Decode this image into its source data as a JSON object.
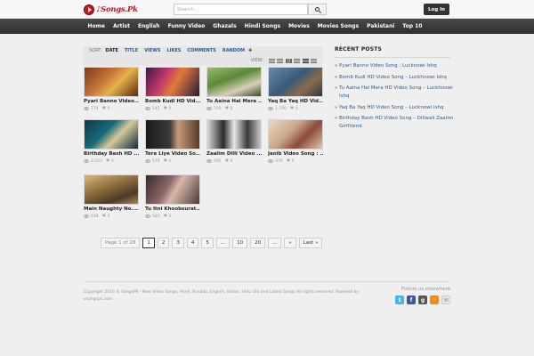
{
  "header": {
    "logo_text": "♪Songs.Pk",
    "search_placeholder": "Search...",
    "login_label": "Log In"
  },
  "nav": {
    "items": [
      "Home",
      "Artist",
      "English",
      "Funny Video",
      "Ghazals",
      "Hindi Songs",
      "Movies",
      "Movies Songs",
      "Pakistani",
      "Top 10"
    ]
  },
  "toolbar": {
    "sort_label": "SORT:",
    "sort_options": [
      "DATE",
      "TITLE",
      "VIEWS",
      "LIKES",
      "COMMENTS",
      "RANDOM"
    ],
    "sort_active": "DATE",
    "view_label": "VIEW:"
  },
  "videos": [
    {
      "title": "Pyari Banno Video...",
      "views": "774",
      "likes": "0"
    },
    {
      "title": "Bomb Kudi HD Vid...",
      "views": "545",
      "likes": "0"
    },
    {
      "title": "Tu Aaina Hai Mera ...",
      "views": "705",
      "likes": "0"
    },
    {
      "title": "Yaq Ba Yaq HD Vid...",
      "views": "1,700",
      "likes": "0"
    },
    {
      "title": "Birthday Bash HD ...",
      "views": "2,023",
      "likes": "0"
    },
    {
      "title": "Tere Liye Video So...",
      "views": "570",
      "likes": "0"
    },
    {
      "title": "Zaalim Dilli Video ...",
      "views": "495",
      "likes": "0"
    },
    {
      "title": "Janib Video Song : ...",
      "views": "378",
      "likes": "0"
    },
    {
      "title": "Main Naughty No....",
      "views": "634",
      "likes": "0"
    },
    {
      "title": "Tu Itni Khoobsurat...",
      "views": "583",
      "likes": "0"
    }
  ],
  "pagination": {
    "info": "Page 1 of 28",
    "pages": [
      "1",
      "2",
      "3",
      "4",
      "5",
      "...",
      "10",
      "20",
      "...",
      "»",
      "Last »"
    ],
    "current": "1"
  },
  "sidebar": {
    "title": "RECENT POSTS",
    "posts": [
      "Pyari Banno Video Song : Lucknowi Ishq",
      "Bomb Kudi HD Video Song – Luckhnowi Ishq",
      "Tu Aaina Hai Mera HD Video Song – Luckhnowi Ishq",
      "Yaq Ba Yaq HD Video Song – Lucknowi Ishq",
      "Birthday Bash HD Video Song – Dillwali Zaalim Girlfriend"
    ]
  },
  "footer": {
    "copyright": "Copyright 2016 © SongsPK - New Video Songs, Hindi, Punjabi, English, Indian, Urdu Old and Latest Songs All rights reserved. Powered by vsongspk.com",
    "follow_label": "Follow us elsewhere",
    "social_icons": [
      "twitter-icon",
      "facebook-icon",
      "google-plus-icon",
      "rss-icon",
      "email-icon"
    ]
  },
  "colors": {
    "nav_bg": "#333333",
    "link": "#2a5d92",
    "logo_red": "#c41717"
  }
}
